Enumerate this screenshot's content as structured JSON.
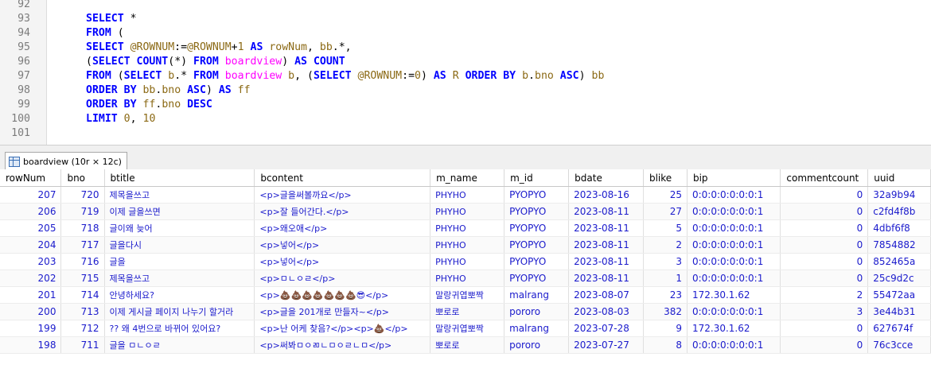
{
  "editor": {
    "lines": [
      {
        "n": "92",
        "tokens": []
      },
      {
        "n": "93",
        "tokens": [
          [
            "kw",
            "SELECT"
          ],
          [
            "op",
            " *"
          ]
        ]
      },
      {
        "n": "94",
        "tokens": [
          [
            "kw",
            "FROM"
          ],
          [
            "op",
            " ("
          ]
        ]
      },
      {
        "n": "95",
        "tokens": [
          [
            "kw",
            "SELECT"
          ],
          [
            "op",
            " "
          ],
          [
            "var",
            "@ROWNUM"
          ],
          [
            "op",
            ":="
          ],
          [
            "var",
            "@ROWNUM"
          ],
          [
            "op",
            "+"
          ],
          [
            "num",
            "1"
          ],
          [
            "op",
            " "
          ],
          [
            "kw",
            "AS"
          ],
          [
            "op",
            " "
          ],
          [
            "id",
            "rowNum"
          ],
          [
            "op",
            ", "
          ],
          [
            "id",
            "bb"
          ],
          [
            "op",
            "."
          ],
          [
            "op",
            "*,"
          ]
        ]
      },
      {
        "n": "96",
        "tokens": [
          [
            "op",
            "("
          ],
          [
            "kw",
            "SELECT"
          ],
          [
            "op",
            " "
          ],
          [
            "fn",
            "COUNT"
          ],
          [
            "op",
            "(*) "
          ],
          [
            "kw",
            "FROM"
          ],
          [
            "op",
            " "
          ],
          [
            "tbl",
            "boardview"
          ],
          [
            "op",
            ") "
          ],
          [
            "kw",
            "AS"
          ],
          [
            "op",
            " "
          ],
          [
            "kw",
            "COUNT"
          ]
        ]
      },
      {
        "n": "97",
        "tokens": [
          [
            "kw",
            "FROM"
          ],
          [
            "op",
            " ("
          ],
          [
            "kw",
            "SELECT"
          ],
          [
            "op",
            " "
          ],
          [
            "id",
            "b"
          ],
          [
            "op",
            ".* "
          ],
          [
            "kw",
            "FROM"
          ],
          [
            "op",
            " "
          ],
          [
            "tbl",
            "boardview"
          ],
          [
            "op",
            " "
          ],
          [
            "id",
            "b"
          ],
          [
            "op",
            ", ("
          ],
          [
            "kw",
            "SELECT"
          ],
          [
            "op",
            " "
          ],
          [
            "var",
            "@ROWNUM"
          ],
          [
            "op",
            ":="
          ],
          [
            "num",
            "0"
          ],
          [
            "op",
            ") "
          ],
          [
            "kw",
            "AS"
          ],
          [
            "op",
            " "
          ],
          [
            "id",
            "R"
          ],
          [
            "op",
            " "
          ],
          [
            "kw",
            "ORDER BY"
          ],
          [
            "op",
            " "
          ],
          [
            "id",
            "b"
          ],
          [
            "op",
            "."
          ],
          [
            "id",
            "bno"
          ],
          [
            "op",
            " "
          ],
          [
            "kw",
            "ASC"
          ],
          [
            "op",
            ") "
          ],
          [
            "id",
            "bb"
          ]
        ]
      },
      {
        "n": "98",
        "tokens": [
          [
            "kw",
            "ORDER BY"
          ],
          [
            "op",
            " "
          ],
          [
            "id",
            "bb"
          ],
          [
            "op",
            "."
          ],
          [
            "id",
            "bno"
          ],
          [
            "op",
            " "
          ],
          [
            "kw",
            "ASC"
          ],
          [
            "op",
            ") "
          ],
          [
            "kw",
            "AS"
          ],
          [
            "op",
            " "
          ],
          [
            "id",
            "ff"
          ]
        ]
      },
      {
        "n": "99",
        "tokens": [
          [
            "kw",
            "ORDER BY"
          ],
          [
            "op",
            " "
          ],
          [
            "id",
            "ff"
          ],
          [
            "op",
            "."
          ],
          [
            "id",
            "bno"
          ],
          [
            "op",
            " "
          ],
          [
            "kw",
            "DESC"
          ]
        ]
      },
      {
        "n": "100",
        "tokens": [
          [
            "kw",
            "LIMIT"
          ],
          [
            "op",
            " "
          ],
          [
            "num",
            "0"
          ],
          [
            "op",
            ", "
          ],
          [
            "num",
            "10"
          ]
        ]
      },
      {
        "n": "101",
        "tokens": []
      }
    ]
  },
  "tab": {
    "label": "boardview (10r × 12c)"
  },
  "grid": {
    "columns": [
      "rowNum",
      "bno",
      "btitle",
      "bcontent",
      "m_name",
      "m_id",
      "bdate",
      "blike",
      "bip",
      "commentcount",
      "uuid"
    ],
    "rows": [
      [
        "207",
        "720",
        "제목을쓰고",
        "<p>글을써볼까요</p>",
        "PHYHO",
        "PYOPYO",
        "2023-08-16",
        "25",
        "0:0:0:0:0:0:0:1",
        "0",
        "32a9b94"
      ],
      [
        "206",
        "719",
        "이제 글을쓰면",
        "<p>잘 들어간다.</p>",
        "PHYHO",
        "PYOPYO",
        "2023-08-11",
        "27",
        "0:0:0:0:0:0:0:1",
        "0",
        "c2fd4f8b"
      ],
      [
        "205",
        "718",
        "글이왜 늦어",
        "<p>왜오애</p>",
        "PHYHO",
        "PYOPYO",
        "2023-08-11",
        "5",
        "0:0:0:0:0:0:0:1",
        "0",
        "4dbf6f8"
      ],
      [
        "204",
        "717",
        "글을다시",
        "<p>넣어</p>",
        "PHYHO",
        "PYOPYO",
        "2023-08-11",
        "2",
        "0:0:0:0:0:0:0:1",
        "0",
        "7854882"
      ],
      [
        "203",
        "716",
        "글을",
        "<p>넣어</p>",
        "PHYHO",
        "PYOPYO",
        "2023-08-11",
        "3",
        "0:0:0:0:0:0:0:1",
        "0",
        "852465a"
      ],
      [
        "202",
        "715",
        "제목을쓰고",
        "<p>ㅁㄴㅇㄹ</p>",
        "PHYHO",
        "PYOPYO",
        "2023-08-11",
        "1",
        "0:0:0:0:0:0:0:1",
        "0",
        "25c9d2c"
      ],
      [
        "201",
        "714",
        "안녕하세요?",
        "<p>💩💩💩💩💩💩💩😎</p>",
        "말랑귀엽뽀짝",
        "malrang",
        "2023-08-07",
        "23",
        "172.30.1.62",
        "2",
        "55472aa"
      ],
      [
        "200",
        "713",
        "이제 게시글 페이지 나누기 할거라",
        "<p>글을 201개로 만들자~</p>",
        "뽀로로",
        "pororo",
        "2023-08-03",
        "382",
        "0:0:0:0:0:0:0:1",
        "3",
        "3e44b31"
      ],
      [
        "199",
        "712",
        "?? 왜 4번으로 바뀌어 있어요?",
        "<p>난 어케 찾음?</p><p>💩</p>",
        "말랑귀엽뽀짝",
        "malrang",
        "2023-07-28",
        "9",
        "172.30.1.62",
        "0",
        "627674f"
      ],
      [
        "198",
        "711",
        "글을 ㅁㄴㅇㄹ",
        "<p>써봐ㅁㅇㄻㄴㅁㅇㄹㄴㅁ</p>",
        "뽀로로",
        "pororo",
        "2023-07-27",
        "8",
        "0:0:0:0:0:0:0:1",
        "0",
        "76c3cce"
      ]
    ]
  }
}
